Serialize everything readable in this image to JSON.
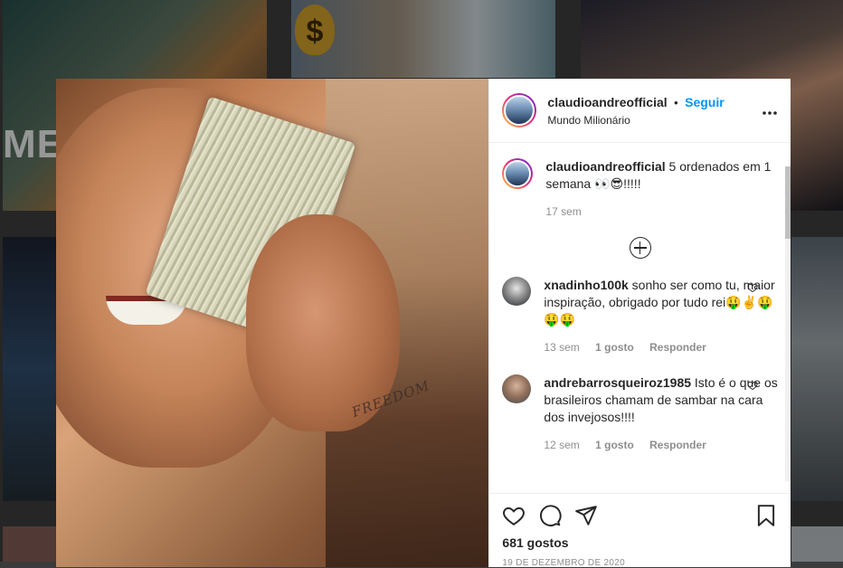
{
  "background": {
    "overlay_text": "MEU",
    "coin_symbol": "$"
  },
  "post": {
    "photo_tattoo_text": "FREEDOM",
    "header": {
      "username": "claudioandreofficial",
      "separator": "•",
      "follow_label": "Seguir",
      "location": "Mundo Milionário",
      "more_label": "..."
    },
    "caption": {
      "username": "claudioandreofficial",
      "text": "5 ordenados em 1 semana 👀😎!!!!!",
      "time": "17 sem"
    },
    "comments": [
      {
        "username": "xnadinho100k",
        "text": "sonho ser como tu, maior inspiração, obrigado por tudo rei🤑✌️🤑🤑🤑",
        "time": "13 sem",
        "likes": "1 gosto",
        "reply_label": "Responder"
      },
      {
        "username": "andrebarrosqueiroz1985",
        "text": "Isto é o que os brasileiros chamam de sambar na cara dos invejosos!!!!",
        "time": "12 sem",
        "likes": "1 gosto",
        "reply_label": "Responder"
      }
    ],
    "likes_count": "681 gostos",
    "date": "19 DE DEZEMBRO DE 2020"
  },
  "icons": [
    "more-options-icon",
    "load-more-comments-icon",
    "heart-icon",
    "comment-icon",
    "share-icon",
    "bookmark-icon"
  ]
}
